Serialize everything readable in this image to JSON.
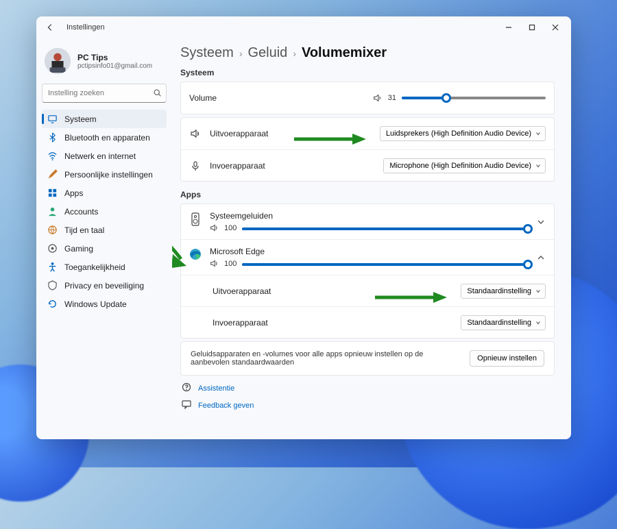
{
  "titlebar": {
    "title": "Instellingen"
  },
  "profile": {
    "name": "PC Tips",
    "email": "pctipsinfo01@gmail.com"
  },
  "search": {
    "placeholder": "Instelling zoeken"
  },
  "nav": {
    "items": [
      {
        "label": "Systeem"
      },
      {
        "label": "Bluetooth en apparaten"
      },
      {
        "label": "Netwerk en internet"
      },
      {
        "label": "Persoonlijke instellingen"
      },
      {
        "label": "Apps"
      },
      {
        "label": "Accounts"
      },
      {
        "label": "Tijd en taal"
      },
      {
        "label": "Gaming"
      },
      {
        "label": "Toegankelijkheid"
      },
      {
        "label": "Privacy en beveiliging"
      },
      {
        "label": "Windows Update"
      }
    ]
  },
  "breadcrumb": {
    "a": "Systeem",
    "b": "Geluid",
    "c": "Volumemixer"
  },
  "sections": {
    "system": "Systeem",
    "apps": "Apps"
  },
  "system": {
    "volume_label": "Volume",
    "volume_value": "31",
    "output_label": "Uitvoerapparaat",
    "output_value": "Luidsprekers (High Definition Audio Device)",
    "input_label": "Invoerapparaat",
    "input_value": "Microphone (High Definition Audio Device)"
  },
  "apps": {
    "sys_sounds": {
      "name": "Systeemgeluiden",
      "vol": "100"
    },
    "edge": {
      "name": "Microsoft Edge",
      "vol": "100",
      "output_label": "Uitvoerapparaat",
      "output_value": "Standaardinstelling",
      "input_label": "Invoerapparaat",
      "input_value": "Standaardinstelling"
    }
  },
  "reset": {
    "text": "Geluidsapparaten en -volumes voor alle apps opnieuw instellen op de aanbevolen standaardwaarden",
    "button": "Opnieuw instellen"
  },
  "links": {
    "assist": "Assistentie",
    "feedback": "Feedback geven"
  }
}
